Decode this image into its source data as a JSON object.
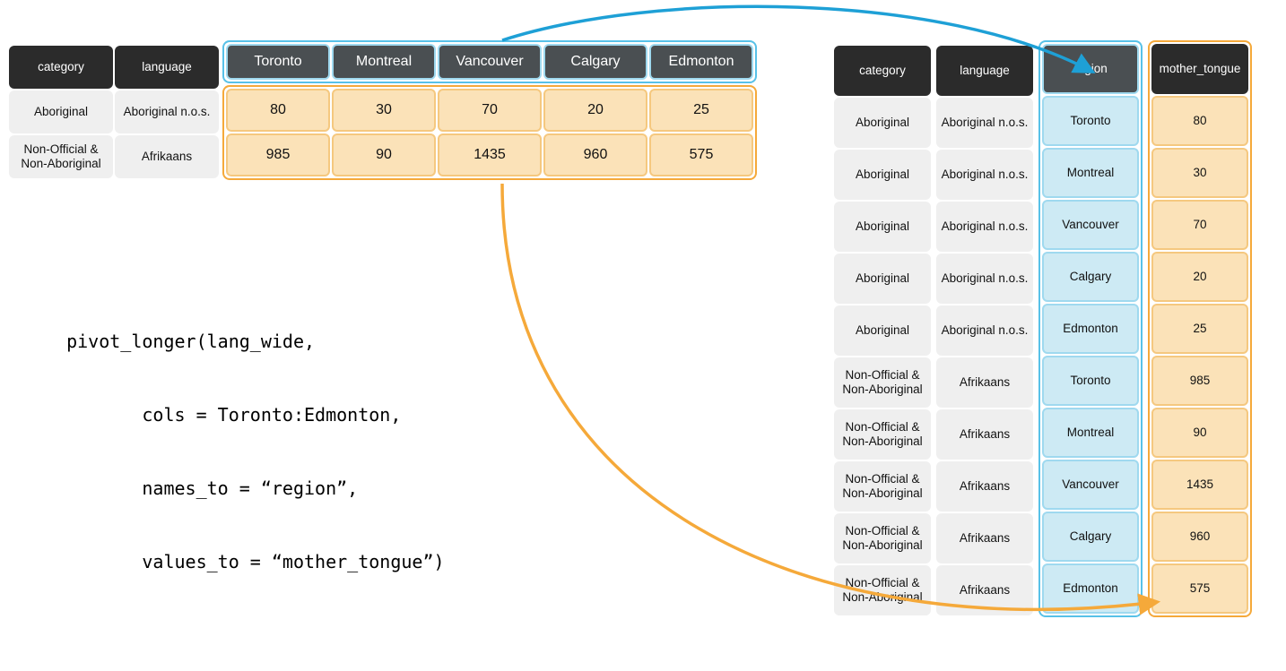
{
  "wide_table": {
    "headers": {
      "category": "category",
      "language": "language",
      "cities": [
        "Toronto",
        "Montreal",
        "Vancouver",
        "Calgary",
        "Edmonton"
      ]
    },
    "rows": [
      {
        "category": "Aboriginal",
        "language": "Aboriginal n.o.s.",
        "values": [
          80,
          30,
          70,
          20,
          25
        ]
      },
      {
        "category": "Non-Official & Non-Aboriginal",
        "language": "Afrikaans",
        "values": [
          985,
          90,
          1435,
          960,
          575
        ]
      }
    ]
  },
  "long_table": {
    "headers": {
      "category": "category",
      "language": "language",
      "region": "region",
      "mother_tongue": "mother_tongue"
    },
    "rows": [
      {
        "category": "Aboriginal",
        "language": "Aboriginal n.o.s.",
        "region": "Toronto",
        "mother_tongue": 80
      },
      {
        "category": "Aboriginal",
        "language": "Aboriginal n.o.s.",
        "region": "Montreal",
        "mother_tongue": 30
      },
      {
        "category": "Aboriginal",
        "language": "Aboriginal n.o.s.",
        "region": "Vancouver",
        "mother_tongue": 70
      },
      {
        "category": "Aboriginal",
        "language": "Aboriginal n.o.s.",
        "region": "Calgary",
        "mother_tongue": 20
      },
      {
        "category": "Aboriginal",
        "language": "Aboriginal n.o.s.",
        "region": "Edmonton",
        "mother_tongue": 25
      },
      {
        "category": "Non-Official & Non-Aboriginal",
        "language": "Afrikaans",
        "region": "Toronto",
        "mother_tongue": 985
      },
      {
        "category": "Non-Official & Non-Aboriginal",
        "language": "Afrikaans",
        "region": "Montreal",
        "mother_tongue": 90
      },
      {
        "category": "Non-Official & Non-Aboriginal",
        "language": "Afrikaans",
        "region": "Vancouver",
        "mother_tongue": 1435
      },
      {
        "category": "Non-Official & Non-Aboriginal",
        "language": "Afrikaans",
        "region": "Calgary",
        "mother_tongue": 960
      },
      {
        "category": "Non-Official & Non-Aboriginal",
        "language": "Afrikaans",
        "region": "Edmonton",
        "mother_tongue": 575
      }
    ]
  },
  "code_lines": [
    "pivot_longer(lang_wide,",
    "       cols = Toronto:Edmonton,",
    "       names_to = “region”,",
    "       values_to = “mother_tongue”)"
  ],
  "colors": {
    "blue_border": "#57c1e8",
    "blue_fill": "#cdeaf4",
    "orange_border": "#f5a93a",
    "orange_fill": "#fbe2b8",
    "header_bg": "#2b2b2b",
    "cell_bg": "#efefef"
  }
}
